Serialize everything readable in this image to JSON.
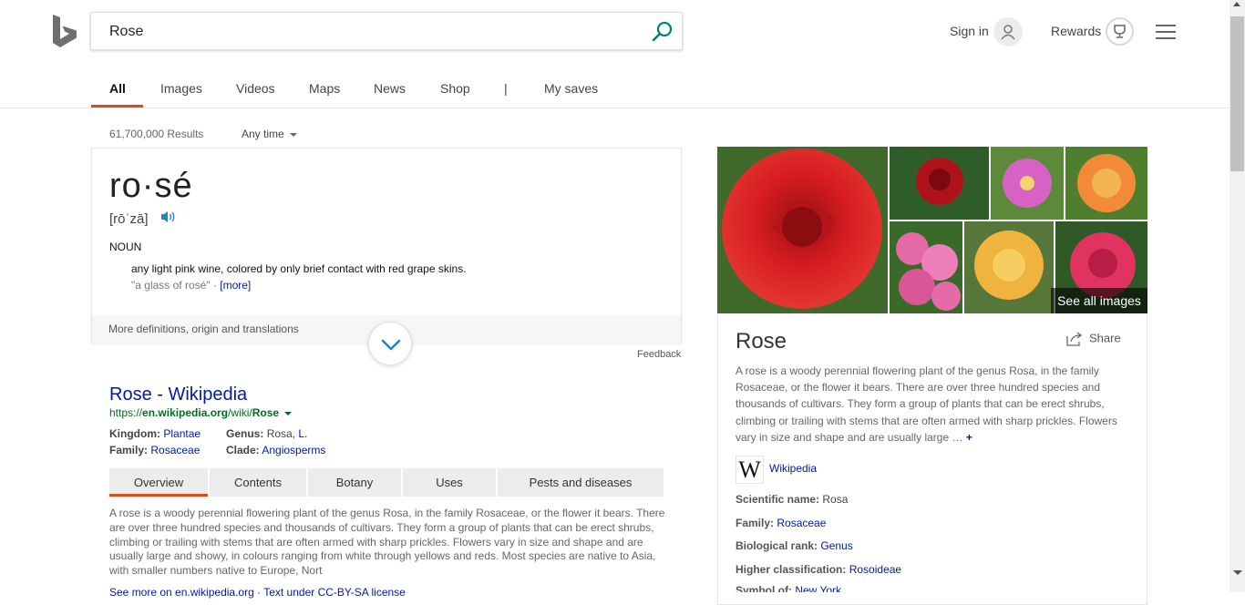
{
  "search": {
    "query": "Rose"
  },
  "header": {
    "signin": "Sign in",
    "rewards": "Rewards"
  },
  "nav": {
    "tabs": [
      "All",
      "Images",
      "Videos",
      "Maps",
      "News",
      "Shop",
      "|",
      "My saves"
    ]
  },
  "results": {
    "count": "61,700,000 Results",
    "time_filter": "Any time"
  },
  "definition": {
    "word": "ro·sé",
    "pronunciation": "[rōˈzā]",
    "part_of_speech": "NOUN",
    "meaning": "any light pink wine, colored by only brief contact with red grape skins.",
    "example": "\"a glass of rosé\" · ",
    "more": "[more]",
    "footer": "More definitions, origin and translations",
    "feedback": "Feedback"
  },
  "wiki": {
    "title": "Rose - Wikipedia",
    "url_prefix": "https://",
    "url_domain": "en.wikipedia.org",
    "url_path": "/wiki/",
    "url_end": "Rose",
    "facts": {
      "kingdom_label": "Kingdom:",
      "kingdom_value": "Plantae",
      "genus_label": "Genus:",
      "genus_value": "Rosa, ",
      "genus_link": "L.",
      "family_label": "Family:",
      "family_value": "Rosaceae",
      "clade_label": "Clade:",
      "clade_value": "Angiosperms"
    },
    "tabs": [
      "Overview",
      "Contents",
      "Botany",
      "Uses",
      "Pests and diseases"
    ],
    "paragraph": "A rose is a woody perennial flowering plant of the genus Rosa, in the family Rosaceae, or the flower it bears. There are over three hundred species and thousands of cultivars. They form a group of plants that can be erect shrubs, climbing or trailing with stems that are often armed with sharp prickles. Flowers vary in size and shape and are usually large and showy, in colours ranging from white through yellows and reds. Most species are native to Asia, with smaller numbers native to Europe, Nort",
    "see_more": "See more on en.wikipedia.org · Text under CC-BY-SA license"
  },
  "panel": {
    "see_all": "See all images",
    "title": "Rose",
    "share": "Share",
    "description": "A rose is a woody perennial flowering plant of the genus Rosa, in the family Rosaceae, or the flower it bears. There are over three hundred species and thousands of cultivars. They form a group of plants that can be erect shrubs, climbing or trailing with stems that are often armed with sharp prickles. Flowers vary in size and shape and are usually large …",
    "plus": "+",
    "source": "Wikipedia",
    "facts": [
      {
        "label": "Scientific name:",
        "value": "Rosa",
        "is_link": false
      },
      {
        "label": "Family:",
        "value": "Rosaceae",
        "is_link": true
      },
      {
        "label": "Biological rank:",
        "value": "Genus",
        "is_link": true
      },
      {
        "label": "Higher classification:",
        "value": "Rosoideae",
        "is_link": true
      },
      {
        "label": "Symbol of:",
        "value": "New York",
        "is_link": true
      }
    ]
  },
  "colors": {
    "accent": "#de4a1f",
    "link": "#001ba0",
    "url": "#006d21",
    "brand_icon": "#008373"
  }
}
